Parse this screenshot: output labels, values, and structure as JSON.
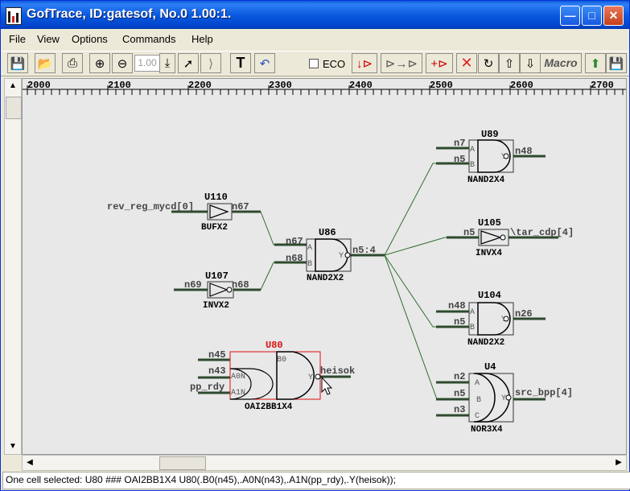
{
  "window": {
    "title": "GofTrace, ID:gatesof, No.0 1.00:1."
  },
  "menu": [
    "File",
    "View",
    "Options",
    "Commands",
    "Help"
  ],
  "toolbar": {
    "zoom_value": "1.00",
    "eco_label": "ECO",
    "macro_label": "Macro"
  },
  "ruler": {
    "ticks": [
      "2000",
      "2100",
      "2200",
      "2300",
      "2400",
      "2500",
      "2600",
      "2700"
    ]
  },
  "cells": [
    {
      "id": "U89",
      "type": "NAND2X4",
      "pins": [
        "A",
        "B",
        "Y"
      ],
      "nets": [
        "n7",
        "n5",
        "n48"
      ]
    },
    {
      "id": "U110",
      "type": "BUFX2",
      "nets": [
        "rev_reg_mycd[0]",
        "n67"
      ]
    },
    {
      "id": "U105",
      "type": "INVX4",
      "nets": [
        "n5",
        "\\tar_cdp[4]"
      ]
    },
    {
      "id": "U86",
      "type": "NAND2X2",
      "pins": [
        "A",
        "B",
        "Y"
      ],
      "nets": [
        "n67",
        "n68",
        "n5:4"
      ]
    },
    {
      "id": "U107",
      "type": "INVX2",
      "nets": [
        "n69",
        "n68"
      ]
    },
    {
      "id": "U104",
      "type": "NAND2X2",
      "pins": [
        "A",
        "B",
        "Y"
      ],
      "nets": [
        "n48",
        "n5",
        "n26"
      ]
    },
    {
      "id": "U80",
      "type": "OAI2BB1X4",
      "pins": [
        "B0",
        "A0N",
        "A1N",
        "Y"
      ],
      "nets": [
        "n45",
        "n43",
        "pp_rdy",
        "heisok"
      ],
      "selected": true
    },
    {
      "id": "U4",
      "type": "NOR3X4",
      "pins": [
        "A",
        "B",
        "C",
        "Y"
      ],
      "nets": [
        "n2",
        "n5",
        "n3",
        "src_bpp[4]"
      ]
    }
  ],
  "colors": {
    "wire": "#2f5f2f",
    "bus": "#1e6b1e",
    "label": "#4a4a4a",
    "selected": "#dd1111",
    "canvas": "#E8E8E8"
  },
  "status": "One cell selected: U80 ### OAI2BB1X4 U80(.B0(n45),.A0N(n43),.A1N(pp_rdy),.Y(heisok));"
}
